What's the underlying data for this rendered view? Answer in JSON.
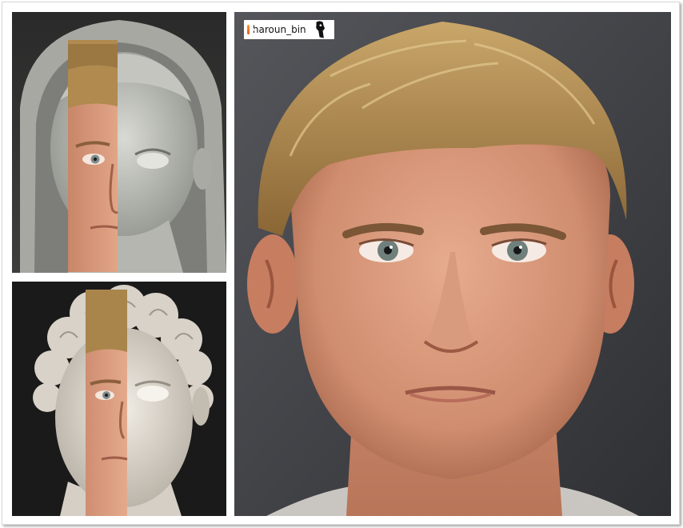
{
  "watermark": {
    "handle": "haroun_bin",
    "icon": "instagram-icon",
    "logo": "profile-logo"
  },
  "panels": [
    {
      "id": "panel-tl",
      "subject": "veiled-marble-bust-half-face-composite"
    },
    {
      "id": "panel-bl",
      "subject": "marble-bust-curly-hair-half-face-composite"
    },
    {
      "id": "panel-r",
      "subject": "photorealistic-face-reconstruction"
    }
  ],
  "colors": {
    "marble": "#cfd0cb",
    "skin": "#d99a7c",
    "hair": "#b08a4f",
    "background_dark": "#3b3b3e"
  }
}
